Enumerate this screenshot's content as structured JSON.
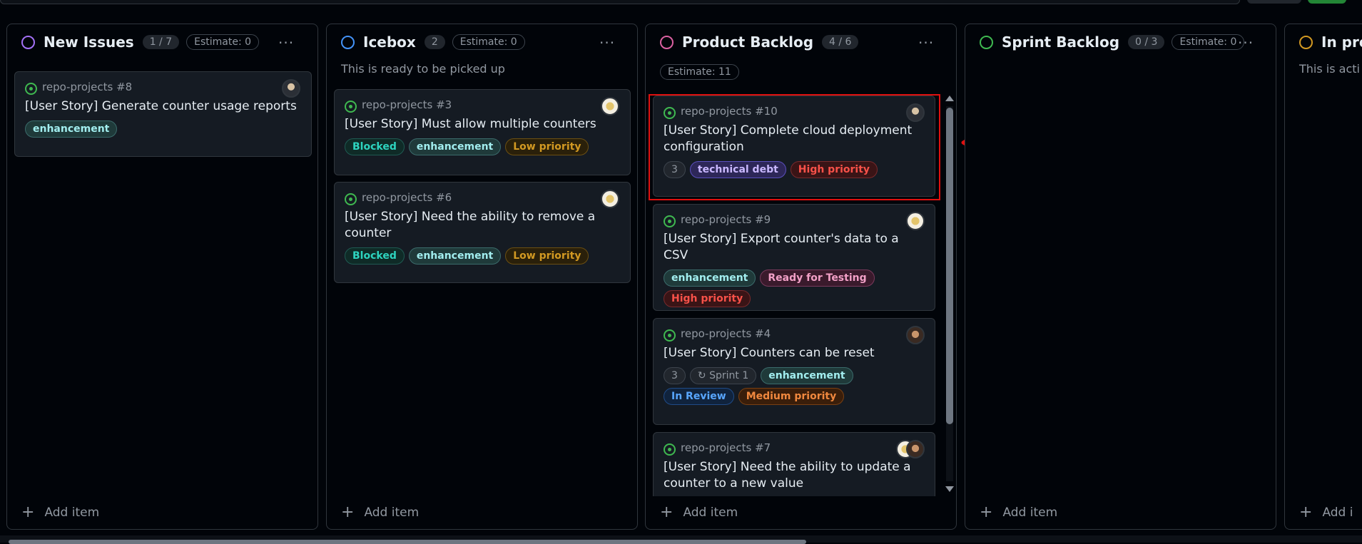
{
  "columns": [
    {
      "title": "New Issues",
      "count": "1 / 7",
      "estimate": "Estimate: 0",
      "ring_color": "#a371f7",
      "add_item": "Add item",
      "cards": [
        {
          "ref": "repo-projects #8",
          "title": "[User Story] Generate counter usage reports",
          "labels": [
            "enhancement"
          ]
        }
      ]
    },
    {
      "title": "Icebox",
      "count": "2",
      "estimate": "Estimate: 0",
      "ring_color": "#4493f8",
      "description": "This is ready to be picked up",
      "add_item": "Add item",
      "cards": [
        {
          "ref": "repo-projects #3",
          "title": "[User Story] Must allow multiple counters",
          "labels": [
            "Blocked",
            "enhancement",
            "Low priority"
          ]
        },
        {
          "ref": "repo-projects #6",
          "title": "[User Story] Need the ability to remove a counter",
          "labels": [
            "Blocked",
            "enhancement",
            "Low priority"
          ]
        }
      ]
    },
    {
      "title": "Product Backlog",
      "count": "4 / 6",
      "estimate": "Estimate: 11",
      "ring_color": "#db61a2",
      "add_item": "Add item",
      "cards": [
        {
          "ref": "repo-projects #10",
          "title": "[User Story] Complete cloud deployment configuration",
          "labels": [
            "3",
            "technical debt",
            "High priority"
          ]
        },
        {
          "ref": "repo-projects #9",
          "title": "[User Story] Export counter's data to a CSV",
          "labels": [
            "enhancement",
            "Ready for Testing",
            "High priority"
          ]
        },
        {
          "ref": "repo-projects #4",
          "title": "[User Story] Counters can be reset",
          "labels": [
            "3",
            "Sprint 1",
            "enhancement",
            "In Review",
            "Medium priority"
          ]
        },
        {
          "ref": "repo-projects #7",
          "title": "[User Story] Need the ability to update a counter to a new value"
        }
      ]
    },
    {
      "title": "Sprint Backlog",
      "count": "0 / 3",
      "estimate": "Estimate: 0",
      "ring_color": "#3fb950",
      "add_item": "Add item"
    },
    {
      "title": "In pro",
      "ring_color": "#d29922",
      "description": "This is acti",
      "add_item": "Add i"
    }
  ],
  "menu_glyph": "···",
  "plus_glyph": "+"
}
